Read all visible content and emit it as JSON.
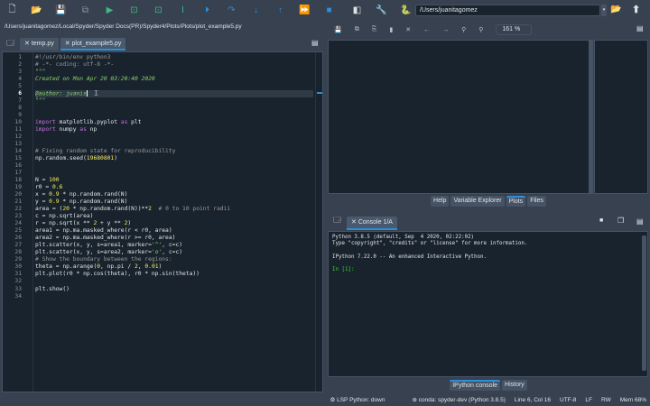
{
  "toolbar": {
    "icons": [
      [
        "new-file-icon",
        "🗋",
        ""
      ],
      [
        "open-file-icon",
        "📂",
        ""
      ],
      [
        "save-icon",
        "💾",
        "d"
      ],
      [
        "save-all-icon",
        "⧉",
        "d"
      ],
      [
        "run-icon",
        "▶",
        "g"
      ],
      [
        "run-cell-icon",
        "⊡",
        "g"
      ],
      [
        "run-cell-advance-icon",
        "⊡",
        "g"
      ],
      [
        "run-selection-icon",
        "I",
        "g"
      ],
      [
        "debug-icon",
        "⏵",
        "b"
      ],
      [
        "step-over-icon",
        "↷",
        "b"
      ],
      [
        "step-into-icon",
        "↓",
        "b"
      ],
      [
        "step-return-icon",
        "↑",
        "b"
      ],
      [
        "continue-icon",
        "⏩",
        "b"
      ],
      [
        "stop-icon",
        "■",
        "b"
      ],
      [
        "maximize-pane-icon",
        "◧",
        ""
      ],
      [
        "preferences-icon",
        "🔧",
        ""
      ],
      [
        "python-path-icon",
        "🐍",
        ""
      ]
    ],
    "cwd": "/Users/juanitagomez"
  },
  "path": "/Users/juanitagomez/Local/Spyder/Spyder Docs(PR)/Spyder4/Plots/Plots/plot_example5.py",
  "editor": {
    "tabs": [
      {
        "label": "temp.py",
        "active": false
      },
      {
        "label": "plot_example5.py",
        "active": true
      }
    ],
    "current_line": 6,
    "lines": [
      [
        [
          "#!/usr/bin/env python3",
          "com"
        ]
      ],
      [
        [
          "# -*- coding: utf-8 -*-",
          "com"
        ]
      ],
      [
        [
          "\"\"\"",
          "str"
        ]
      ],
      [
        [
          "Created on Mon Apr 20 03:20:40 2020",
          "str"
        ]
      ],
      [],
      [
        [
          "@author: juanis",
          "str"
        ]
      ],
      [
        [
          "\"\"\"",
          "str"
        ]
      ],
      [],
      [],
      [
        [
          "import",
          "kw"
        ],
        [
          " matplotlib.pyplot ",
          "op"
        ],
        [
          "as",
          "kw"
        ],
        [
          " plt",
          "op"
        ]
      ],
      [
        [
          "import",
          "kw"
        ],
        [
          " numpy ",
          "op"
        ],
        [
          "as",
          "kw"
        ],
        [
          " np",
          "op"
        ]
      ],
      [],
      [],
      [
        [
          "# Fixing random state for reproducibility",
          "com"
        ]
      ],
      [
        [
          "np.random.seed(",
          "op"
        ],
        [
          "19680801",
          "num"
        ],
        [
          ")",
          "op"
        ]
      ],
      [],
      [],
      [
        [
          "N = ",
          "op"
        ],
        [
          "100",
          "num"
        ]
      ],
      [
        [
          "r0 = ",
          "op"
        ],
        [
          "0.6",
          "num"
        ]
      ],
      [
        [
          "x = ",
          "op"
        ],
        [
          "0.9",
          "num"
        ],
        [
          " * np.random.rand(N)",
          "op"
        ]
      ],
      [
        [
          "y = ",
          "op"
        ],
        [
          "0.9",
          "num"
        ],
        [
          " * np.random.rand(N)",
          "op"
        ]
      ],
      [
        [
          "area = (",
          "op"
        ],
        [
          "20",
          "num"
        ],
        [
          " * np.random.rand(N))**",
          "op"
        ],
        [
          "2",
          "num"
        ],
        [
          "  # 0 to 10 point radii",
          "com"
        ]
      ],
      [
        [
          "c = np.sqrt(area)",
          "op"
        ]
      ],
      [
        [
          "r = np.sqrt(x ** ",
          "op"
        ],
        [
          "2",
          "num"
        ],
        [
          " + y ** ",
          "op"
        ],
        [
          "2",
          "num"
        ],
        [
          ")",
          "op"
        ]
      ],
      [
        [
          "area1 = np.ma.masked_where(r < r0, area)",
          "op"
        ]
      ],
      [
        [
          "area2 = np.ma.masked_where(r >= r0, area)",
          "op"
        ]
      ],
      [
        [
          "plt.scatter(x, y, s=area1, marker=",
          "op"
        ],
        [
          "'^'",
          "str"
        ],
        [
          ", c=c)",
          "op"
        ]
      ],
      [
        [
          "plt.scatter(x, y, s=area2, marker=",
          "op"
        ],
        [
          "'o'",
          "str"
        ],
        [
          ", c=c)",
          "op"
        ]
      ],
      [
        [
          "# Show the boundary between the regions:",
          "com"
        ]
      ],
      [
        [
          "theta = np.arange(",
          "op"
        ],
        [
          "0",
          "num"
        ],
        [
          ", np.pi / ",
          "op"
        ],
        [
          "2",
          "num"
        ],
        [
          ", ",
          "op"
        ],
        [
          "0.01",
          "num"
        ],
        [
          ")",
          "op"
        ]
      ],
      [
        [
          "plt.plot(r0 * np.cos(theta), r0 * np.sin(theta))",
          "op"
        ]
      ],
      [],
      [
        [
          "plt.show()",
          "op"
        ]
      ],
      []
    ]
  },
  "plots": {
    "zoom": "161 %",
    "tabs": [
      {
        "label": "Help"
      },
      {
        "label": "Variable Explorer"
      },
      {
        "label": "Plots",
        "active": true
      },
      {
        "label": "Files"
      }
    ]
  },
  "console": {
    "tab": "Console 1/A",
    "lines": [
      "Python 3.8.5 (default, Sep  4 2020, 02:22:02)",
      "Type \"copyright\", \"credits\" or \"license\" for more information.",
      "",
      "IPython 7.22.0 -- An enhanced Interactive Python.",
      ""
    ],
    "prompt": "In [1]:",
    "tabs": [
      {
        "label": "IPython console",
        "active": true
      },
      {
        "label": "History"
      }
    ]
  },
  "status": {
    "lsp": "LSP Python: down",
    "conda": "conda: spyder-dev (Python 3.8.5)",
    "position": "Line 6, Col 16",
    "encoding": "UTF-8",
    "eol": "LF",
    "rw": "RW",
    "mem": "Mem 68%"
  },
  "colors": {
    "accent": "#2c8fd8",
    "background": "#19232d",
    "chrome": "#37414f"
  }
}
